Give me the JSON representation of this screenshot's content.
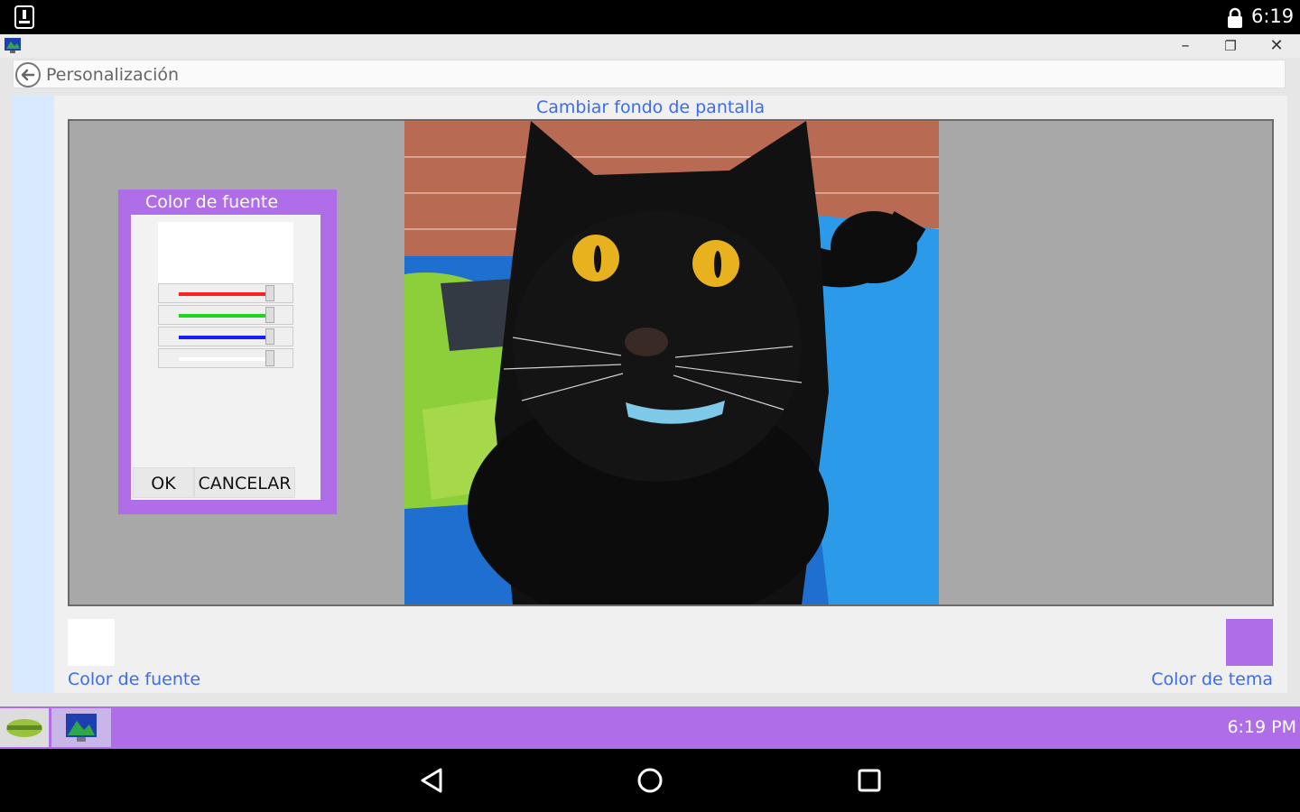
{
  "status_bar": {
    "time": "6:19",
    "left_icon": "notification-icon",
    "lock_icon": "lock-icon"
  },
  "window": {
    "title_bar": {
      "app_icon": "app-icon",
      "minimize": "–",
      "restore": "❐",
      "close": "✕"
    },
    "address": {
      "title": "Personalización",
      "back_icon": "back-arrow-icon"
    },
    "heading": "Cambiar fondo de pantalla",
    "dialog": {
      "title": "Color de fuente",
      "ok": "OK",
      "cancel": "CANCELAR",
      "sliders": [
        {
          "name": "red",
          "color": "#ff2020"
        },
        {
          "name": "green",
          "color": "#1fd61f"
        },
        {
          "name": "blue",
          "color": "#1a1aff"
        },
        {
          "name": "alpha",
          "color": "#ffffff"
        }
      ],
      "preview_color": "#ffffff"
    },
    "font_color": {
      "label": "Color de fuente",
      "color": "#ffffff"
    },
    "theme_color": {
      "label": "Color de tema",
      "color": "#b06de8"
    }
  },
  "taskbar": {
    "clock": "6:19 PM",
    "start_icon": "start-menu-icon",
    "task_icon": "personalization-task-icon"
  },
  "nav_bar": {
    "back": "back-nav-icon",
    "home": "home-nav-icon",
    "recents": "recents-nav-icon"
  }
}
